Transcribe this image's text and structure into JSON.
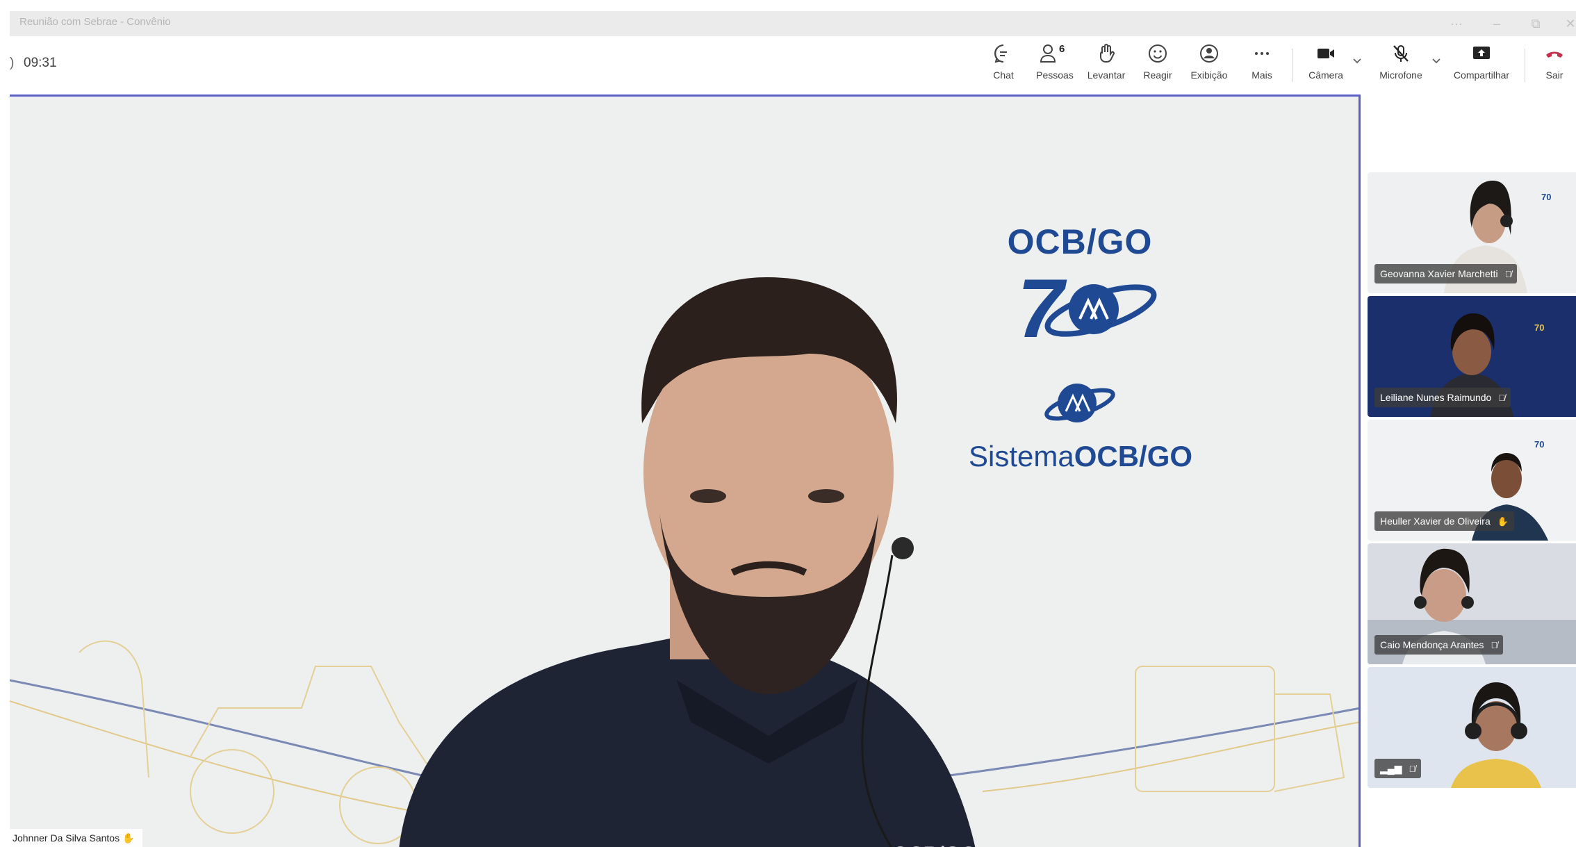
{
  "window": {
    "title": "Reunião com Sebrae - Convênio",
    "controls": [
      "more-icon",
      "minimize-icon",
      "restore-icon",
      "close-icon"
    ]
  },
  "meeting": {
    "elapsed": "09:31"
  },
  "toolbar": {
    "chat": "Chat",
    "people": "Pessoas",
    "people_count": "6",
    "raise": "Levantar",
    "react": "Reagir",
    "view": "Exibição",
    "more": "Mais",
    "camera": "Câmera",
    "mic": "Microfone",
    "share": "Compartilhar",
    "leave": "Sair",
    "leave_color": "#c4314b"
  },
  "main_video": {
    "speaker_name": "Johnner Da Silva Santos",
    "brand_title": "OCB/GO",
    "brand_sistema_prefix": "Sistema",
    "brand_sistema_suffix": "OCB/GO",
    "brand_number": "70",
    "brand_color": "#1f4a93",
    "shirt_brand": "OCB/GO"
  },
  "participants": [
    {
      "name": "Geovanna Xavier Marchetti",
      "bg": "#eef0f1",
      "muted": true
    },
    {
      "name": "Leiliane Nunes Raimundo",
      "bg": "#1a2f6b",
      "muted": true
    },
    {
      "name": "Heuller Xavier de Oliveira",
      "bg": "#f1f2f3",
      "muted": false
    },
    {
      "name": "Caio Mendonça Arantes",
      "bg": "#d9dde3",
      "muted": true
    },
    {
      "name": "",
      "bg": "#dfe5ee",
      "muted": true
    }
  ]
}
